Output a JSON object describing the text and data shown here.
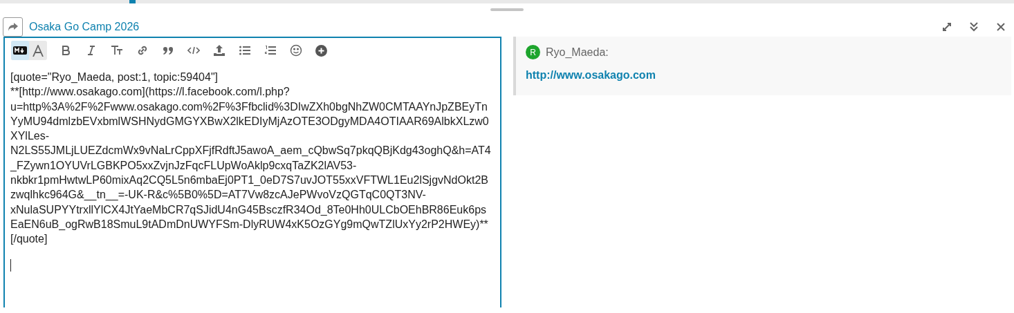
{
  "composer": {
    "title": "Osaka Go Camp 2026"
  },
  "toolbar": {
    "mode_toggle": [
      {
        "kind": "markdown",
        "selected": true
      },
      {
        "kind": "rich",
        "selected": false
      }
    ],
    "tools": [
      {
        "kind": "bold"
      },
      {
        "kind": "italic"
      },
      {
        "kind": "heading"
      },
      {
        "kind": "link"
      },
      {
        "kind": "quote"
      },
      {
        "kind": "code"
      },
      {
        "kind": "upload"
      },
      {
        "kind": "bullets"
      },
      {
        "kind": "numbers"
      },
      {
        "kind": "emoji"
      },
      {
        "kind": "more"
      }
    ]
  },
  "editor": {
    "lines": [
      "[quote=\"Ryo_Maeda, post:1, topic:59404\"]",
      "**[http://www.osakago.com](https://l.facebook.com/l.php?",
      "u=http%3A%2F%2Fwww.osakago.com%2F%3Ffbclid%3DIwZXh0bgNhZW0CMTAAYnJpZBEyTn",
      "YyMU94dmlzbEVxbmlWSHNydGMGYXBwX2lkEDIyMjAzOTE3ODgyMDA4OTIAAR69AlbkXLzw0",
      "XYlLes-",
      "N2LS55JMLjLUEZdcmWx9vNaLrCppXFjfRdftJ5awoA_aem_cQbwSq7pkqQBjKdg43oghQ&h=AT4",
      "_FZywn1OYUVrLGBKPO5xxZvjnJzFqcFLUpWoAklp9cxqTaZK2lAV53-",
      "nkbkr1pmHwtwLP60mixAq2CQ5L5n6mbaEj0PT1_0eD7S7uvJOT55xxVFTWL1Eu2lSjgvNdOkt2B",
      "zwqlhkc964G&__tn__=-UK-R&c%5B0%5D=AT7Vw8zcAJePWvoVzQGTqC0QT3NV-",
      "xNulaSUPYYtrxllYlCX4JtYaeMbCR7qSJidU4nG45BsczfR34Od_8Te0Hh0ULCbOEhBR86Euk6ps",
      "EaEN6uB_ogRwB18SmuL9tADmDnUWYFSm-DlyRUW4xK5OzGYg9mQwTZlUxYy2rP2HWEy)**",
      "[/quote]"
    ]
  },
  "preview": {
    "avatar_letter": "R",
    "username": "Ryo_Maeda:",
    "link": "http://www.osakago.com"
  }
}
